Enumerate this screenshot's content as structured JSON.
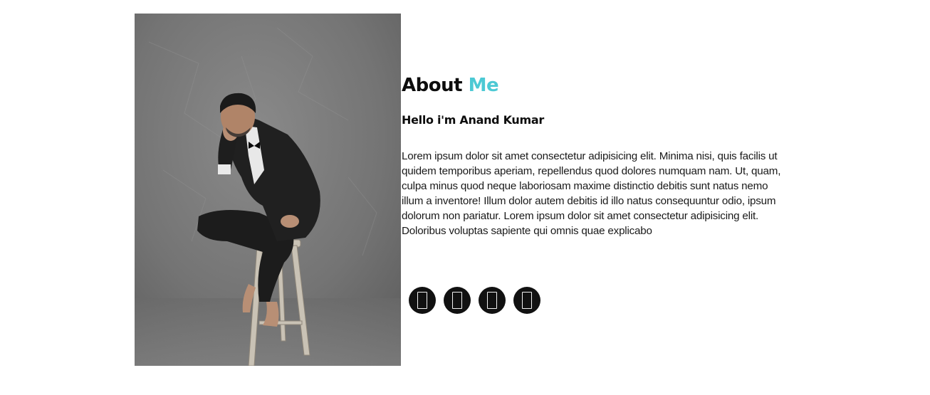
{
  "about": {
    "title_main": "About",
    "title_accent": "Me",
    "subtitle": "Hello i'm Anand Kumar",
    "body": "Lorem ipsum dolor sit amet consectetur adipisicing elit. Minima nisi, quis facilis ut quidem temporibus aperiam, repellendus quod dolores numquam nam. Ut, quam, culpa minus quod neque laboriosam maxime distinctio debitis sunt natus nemo illum a inventore! Illum dolor autem debitis id illo natus consequuntur odio, ipsum dolorum non pariatur. Lorem ipsum dolor sit amet consectetur adipisicing elit. Doloribus voluptas sapiente qui omnis quae explicabo"
  },
  "photo": {
    "icon": "portrait-photo"
  },
  "socials": [
    {
      "icon": "missing-glyph-icon"
    },
    {
      "icon": "missing-glyph-icon"
    },
    {
      "icon": "missing-glyph-icon"
    },
    {
      "icon": "missing-glyph-icon"
    }
  ],
  "colors": {
    "accent": "#4cc9d4",
    "text": "#0d0d0d",
    "social_bg": "#111111"
  }
}
